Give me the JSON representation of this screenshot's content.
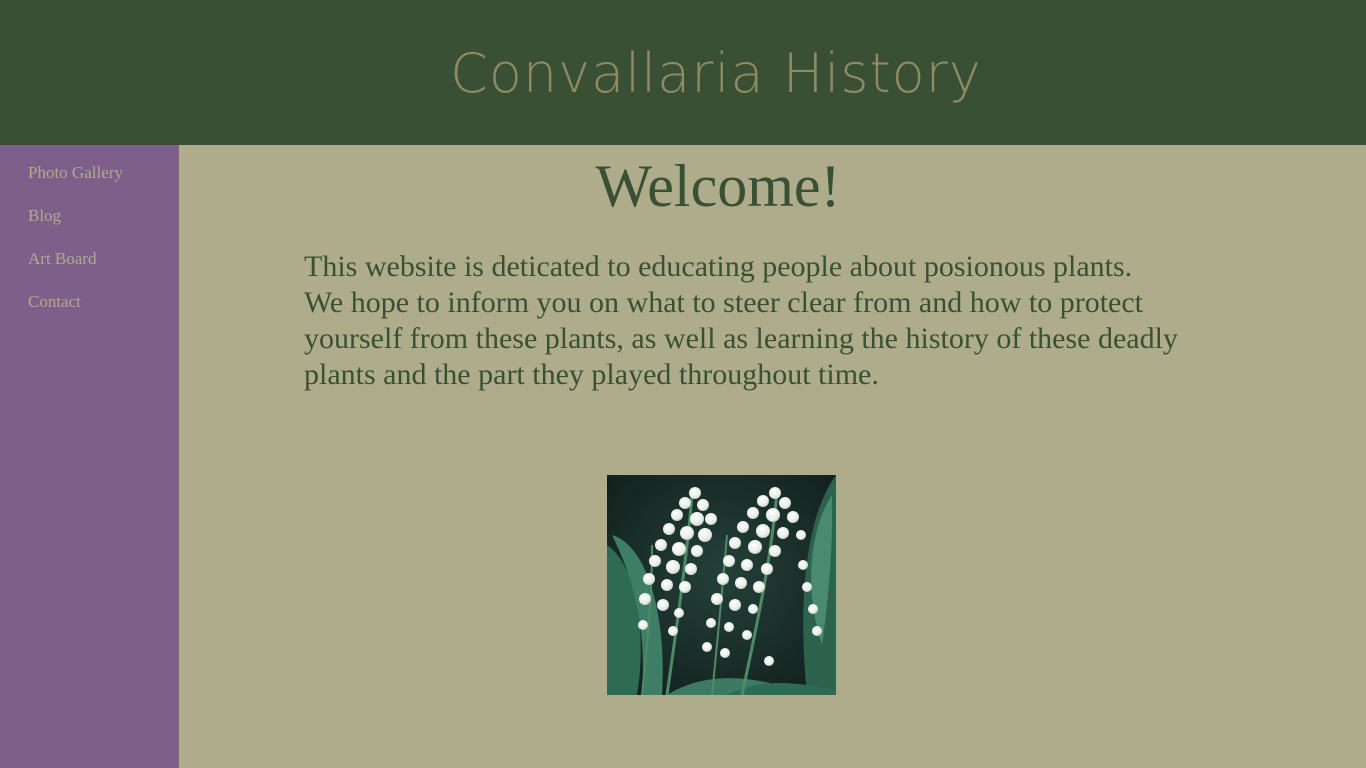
{
  "header": {
    "title": "Convallaria History",
    "background_color": "#3a5034",
    "title_color": "#8e8a64"
  },
  "sidebar": {
    "background_color": "#7e5f8a",
    "link_color": "#aeac8b",
    "items": [
      {
        "label": "Photo Gallery"
      },
      {
        "label": "Blog"
      },
      {
        "label": "Art Board"
      },
      {
        "label": "Contact"
      }
    ]
  },
  "main": {
    "background_color": "#aeac8b",
    "heading": "Welcome!",
    "intro": "This website is deticated to educating people about posionous plants.\nWe hope to inform you on what to steer clear from and how to protect\nyourself from these plants, as well as learning the history of these deadly\n plants and the part they played throughout time.",
    "image": {
      "subject": "lily-of-the-valley-photo"
    }
  }
}
